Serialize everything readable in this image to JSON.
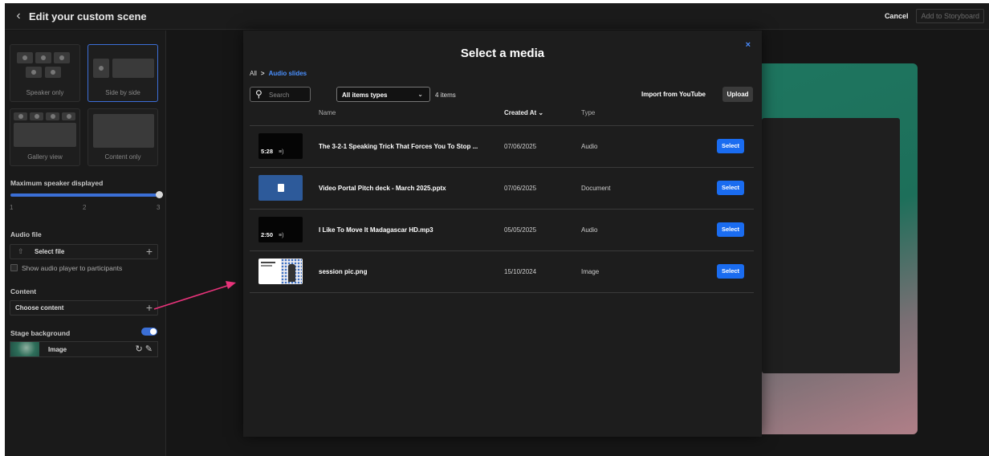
{
  "header": {
    "title": "Edit your custom scene",
    "cancel": "Cancel",
    "add_to_storyboard": "Add to Storyboard"
  },
  "sidebar": {
    "layouts": [
      {
        "label": "Speaker only"
      },
      {
        "label": "Side by side"
      },
      {
        "label": "Gallery view"
      },
      {
        "label": "Content only"
      }
    ],
    "max_speaker_label": "Maximum speaker displayed",
    "slider_ticks": [
      "1",
      "2",
      "3"
    ],
    "slider_value": 3,
    "audio_file_label": "Audio file",
    "select_file": "Select file",
    "show_audio_player": "Show audio player to participants",
    "content_label": "Content",
    "choose_content": "Choose content",
    "stage_background_label": "Stage background",
    "background_type": "Image"
  },
  "modal": {
    "title": "Select a media",
    "close": "×",
    "breadcrumb": {
      "root": "All",
      "separator": ">",
      "current": "Audio slides"
    },
    "search_placeholder": "Search",
    "type_filter": "All items types",
    "item_count": "4 items",
    "import_youtube": "Import from YouTube",
    "upload": "Upload",
    "columns": {
      "name": "Name",
      "created_at": "Created At",
      "type": "Type"
    },
    "rows": [
      {
        "thumb": "audio",
        "duration": "5:28",
        "name": "The 3-2-1 Speaking Trick That Forces You To Stop ...",
        "created": "07/06/2025",
        "type": "Audio",
        "action": "Select"
      },
      {
        "thumb": "doc",
        "duration": "",
        "name": "Video Portal Pitch deck - March 2025.pptx",
        "created": "07/06/2025",
        "type": "Document",
        "action": "Select"
      },
      {
        "thumb": "audio",
        "duration": "2:50",
        "name": "I Like To Move It Madagascar HD.mp3",
        "created": "05/05/2025",
        "type": "Audio",
        "action": "Select"
      },
      {
        "thumb": "img",
        "duration": "",
        "name": "session pic.png",
        "created": "15/10/2024",
        "type": "Image",
        "action": "Select"
      }
    ]
  },
  "colors": {
    "accent": "#1a6cf0",
    "link": "#4a90ff",
    "annotation_arrow": "#e8337a"
  }
}
